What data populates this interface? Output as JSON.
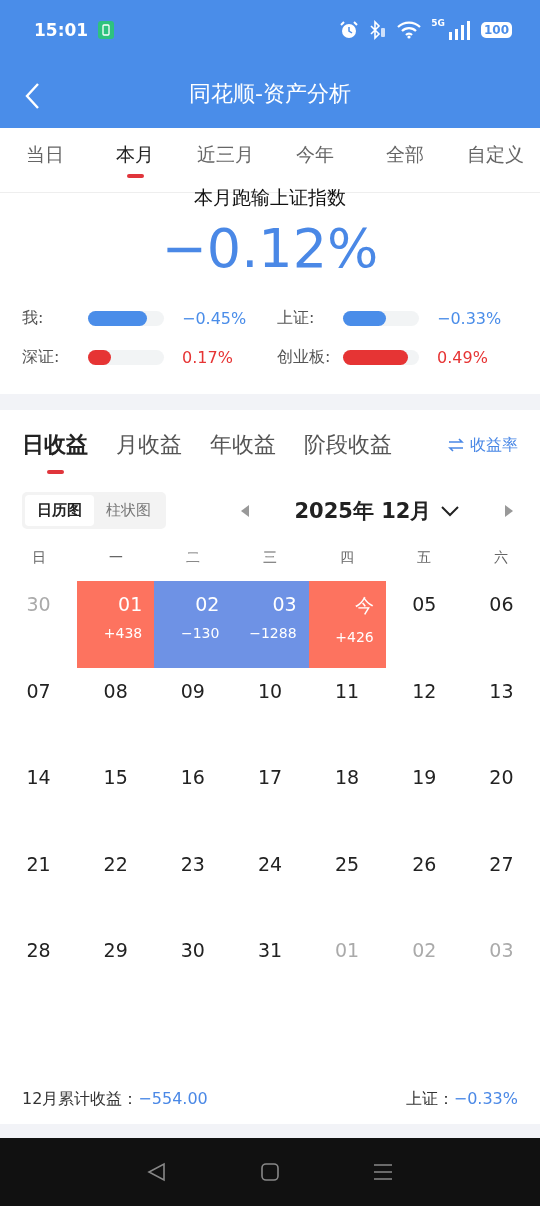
{
  "status_bar": {
    "time": "15:01",
    "battery": "100",
    "network": "5G"
  },
  "header": {
    "title": "同花顺-资产分析"
  },
  "period_tabs": [
    {
      "label": "当日",
      "selected": false
    },
    {
      "label": "本月",
      "selected": true
    },
    {
      "label": "近三月",
      "selected": false
    },
    {
      "label": "今年",
      "selected": false
    },
    {
      "label": "全部",
      "selected": false
    },
    {
      "label": "自定义",
      "selected": false
    }
  ],
  "summary": {
    "caption": "本月跑输上证指数",
    "value": "−0.12%",
    "comparisons": [
      {
        "label": "我:",
        "level": 0.78,
        "color": "#4a8de9",
        "reading": "−0.45%"
      },
      {
        "label": "上证:",
        "level": 0.57,
        "color": "#4a8de9",
        "reading": "−0.33%"
      },
      {
        "label": "深证:",
        "level": 0.3,
        "color": "#e63434",
        "reading": "0.17%"
      },
      {
        "label": "创业板:",
        "level": 0.85,
        "color": "#e63434",
        "reading": "0.49%"
      }
    ]
  },
  "earnings_tabs": [
    {
      "label": "日收益",
      "selected": true
    },
    {
      "label": "月收益",
      "selected": false
    },
    {
      "label": "年收益",
      "selected": false
    },
    {
      "label": "阶段收益",
      "selected": false
    }
  ],
  "rate_toggle": {
    "label": "收益率"
  },
  "view_switch": [
    {
      "label": "日历图",
      "selected": true
    },
    {
      "label": "柱状图",
      "selected": false
    }
  ],
  "month_picker": {
    "label": "2025年 12月"
  },
  "weekdays": [
    "日",
    "一",
    "二",
    "三",
    "四",
    "五",
    "六"
  ],
  "days": [
    {
      "day": "30",
      "kind": "other"
    },
    {
      "day": "01",
      "kind": "current",
      "gain": "+438",
      "color": "#fd735f"
    },
    {
      "day": "02",
      "kind": "current",
      "gain": "−130",
      "color": "#6e92e5"
    },
    {
      "day": "03",
      "kind": "current",
      "gain": "−1288",
      "color": "#6e92e5"
    },
    {
      "day": "今",
      "kind": "current",
      "gain": "+426",
      "color": "#fd735f"
    },
    {
      "day": "05",
      "kind": "current"
    },
    {
      "day": "06",
      "kind": "current"
    },
    {
      "day": "07",
      "kind": "current"
    },
    {
      "day": "08",
      "kind": "current"
    },
    {
      "day": "09",
      "kind": "current"
    },
    {
      "day": "10",
      "kind": "current"
    },
    {
      "day": "11",
      "kind": "current"
    },
    {
      "day": "12",
      "kind": "current"
    },
    {
      "day": "13",
      "kind": "current"
    },
    {
      "day": "14",
      "kind": "current"
    },
    {
      "day": "15",
      "kind": "current"
    },
    {
      "day": "16",
      "kind": "current"
    },
    {
      "day": "17",
      "kind": "current"
    },
    {
      "day": "18",
      "kind": "current"
    },
    {
      "day": "19",
      "kind": "current"
    },
    {
      "day": "20",
      "kind": "current"
    },
    {
      "day": "21",
      "kind": "current"
    },
    {
      "day": "22",
      "kind": "current"
    },
    {
      "day": "23",
      "kind": "current"
    },
    {
      "day": "24",
      "kind": "current"
    },
    {
      "day": "25",
      "kind": "current"
    },
    {
      "day": "26",
      "kind": "current"
    },
    {
      "day": "27",
      "kind": "current"
    },
    {
      "day": "28",
      "kind": "current"
    },
    {
      "day": "29",
      "kind": "current"
    },
    {
      "day": "30",
      "kind": "current"
    },
    {
      "day": "31",
      "kind": "current"
    },
    {
      "day": "01",
      "kind": "other"
    },
    {
      "day": "02",
      "kind": "other"
    },
    {
      "day": "03",
      "kind": "other"
    }
  ],
  "footer": {
    "total_label": "12月累计收益：",
    "total_value": "−554.00",
    "index_label": "上证：",
    "index_value": "−0.33%"
  }
}
